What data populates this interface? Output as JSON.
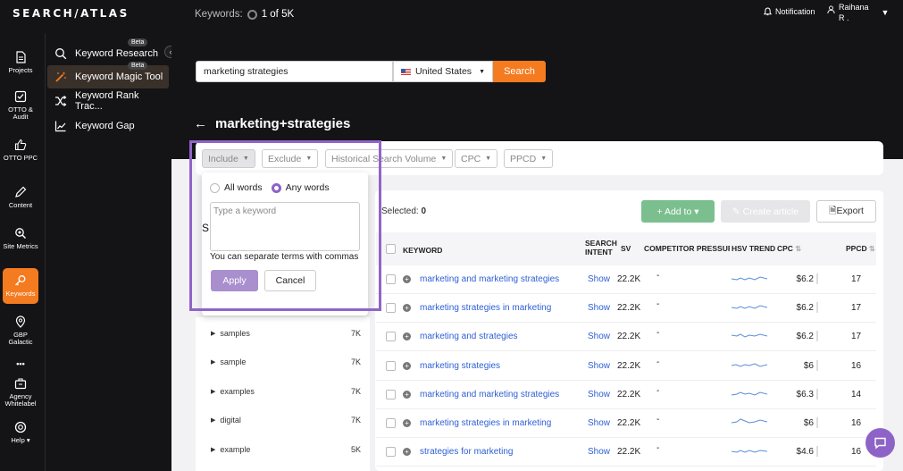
{
  "app": {
    "logo": "SEARCH/ATLAS"
  },
  "header": {
    "keywords_label": "Keywords:",
    "keywords_value": "1 of 5K",
    "notification_label": "Notification",
    "user_name_line1": "Raihana",
    "user_name_line2": "R ."
  },
  "rail": {
    "items": [
      {
        "label": "Projects",
        "icon": "document-icon"
      },
      {
        "label": "OTTO & Audit",
        "icon": "check-square-icon"
      },
      {
        "label": "OTTO PPC",
        "icon": "thumbs-up-icon"
      },
      {
        "label": "Content",
        "icon": "pen-icon"
      },
      {
        "label": "Site Metrics",
        "icon": "magnifier-icon"
      },
      {
        "label": "Keywords",
        "icon": "key-icon",
        "active": true
      },
      {
        "label": "GBP Galactic",
        "icon": "map-pin-icon"
      },
      {
        "label": "Agency Whitelabel",
        "icon": "briefcase-icon"
      },
      {
        "label": "Help",
        "icon": "lifebuoy-icon"
      }
    ],
    "more": "•••"
  },
  "submenu": {
    "items": [
      {
        "label": "Keyword Research",
        "badge": "Beta",
        "icon": "search-icon"
      },
      {
        "label": "Keyword Magic Tool",
        "badge": "Beta",
        "icon": "magic-wand-icon",
        "active": true
      },
      {
        "label": "Keyword Rank Trac...",
        "icon": "shuffle-icon"
      },
      {
        "label": "Keyword Gap",
        "icon": "chart-icon"
      }
    ]
  },
  "search": {
    "query": "marketing strategies",
    "country": "United States",
    "button": "Search"
  },
  "page": {
    "title": "marketing+strategies"
  },
  "filters": {
    "include": "Include",
    "exclude": "Exclude",
    "hsv": "Historical Search Volume",
    "cpc": "CPC",
    "ppcd": "PPCD"
  },
  "popover": {
    "all_words": "All words",
    "any_words": "Any words",
    "placeholder": "Type a keyword",
    "hint": "You can separate terms with commas",
    "apply": "Apply",
    "cancel": "Cancel",
    "typed_char": "S"
  },
  "groups": [
    {
      "name": "samples",
      "count": "7K"
    },
    {
      "name": "sample",
      "count": "7K"
    },
    {
      "name": "examples",
      "count": "7K"
    },
    {
      "name": "digital",
      "count": "7K"
    },
    {
      "name": "example",
      "count": "5K"
    }
  ],
  "toolbar": {
    "selected_label": "Selected:",
    "selected_count": "0",
    "add_to": "Add to",
    "create_article": "Create article",
    "export": "Export"
  },
  "table": {
    "headers": {
      "keyword": "KEYWORD",
      "intent_1": "SEARCH",
      "intent_2": "INTENT",
      "sv": "SV",
      "competitor": "COMPETITOR PRESSURE",
      "hsv": "HSV TREND",
      "cpc": "CPC",
      "ppcd": "PPCD"
    },
    "rows": [
      {
        "keyword": "marketing and marketing strategies",
        "intent": "Show",
        "sv": "22.2K",
        "competitor": "-",
        "cpc": "$6.2",
        "ppcd": "17"
      },
      {
        "keyword": "marketing strategies in marketing",
        "intent": "Show",
        "sv": "22.2K",
        "competitor": "-",
        "cpc": "$6.2",
        "ppcd": "17"
      },
      {
        "keyword": "marketing and strategies",
        "intent": "Show",
        "sv": "22.2K",
        "competitor": "-",
        "cpc": "$6.2",
        "ppcd": "17"
      },
      {
        "keyword": "marketing strategies",
        "intent": "Show",
        "sv": "22.2K",
        "competitor": "-",
        "cpc": "$6",
        "ppcd": "16"
      },
      {
        "keyword": "marketing and marketing strategies",
        "intent": "Show",
        "sv": "22.2K",
        "competitor": "-",
        "cpc": "$6.3",
        "ppcd": "14"
      },
      {
        "keyword": "marketing strategies in marketing",
        "intent": "Show",
        "sv": "22.2K",
        "competitor": "-",
        "cpc": "$6",
        "ppcd": "16"
      },
      {
        "keyword": "strategies for marketing",
        "intent": "Show",
        "sv": "22.2K",
        "competitor": "-",
        "cpc": "$4.6",
        "ppcd": "16"
      }
    ]
  },
  "colors": {
    "accent": "#f47b20",
    "purple": "#8e63c7",
    "link": "#2d5fd4",
    "green": "#7bbf8e",
    "dark": "#141416"
  }
}
